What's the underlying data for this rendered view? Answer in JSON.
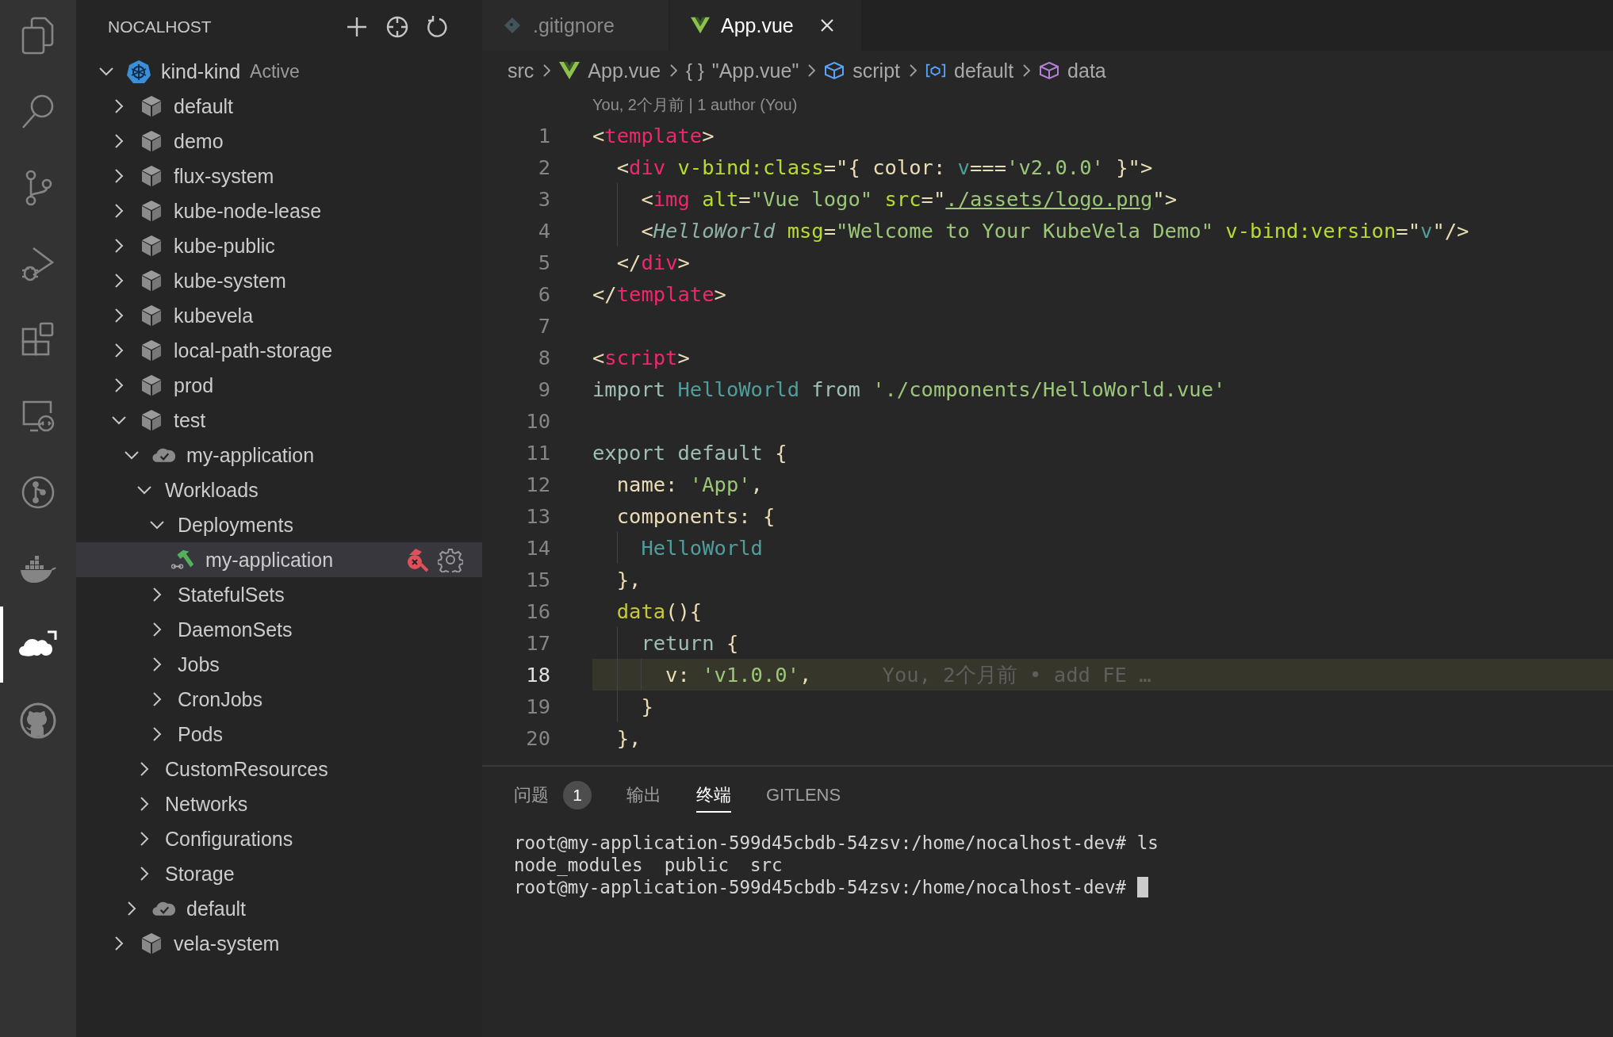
{
  "activity_bar": [
    {
      "kind": "files",
      "selected": false
    },
    {
      "kind": "search",
      "selected": false
    },
    {
      "kind": "source-control",
      "selected": false
    },
    {
      "kind": "run-debug",
      "selected": false
    },
    {
      "kind": "extensions",
      "selected": false
    },
    {
      "kind": "remote",
      "selected": false
    },
    {
      "kind": "git-graph",
      "selected": false
    },
    {
      "kind": "docker",
      "selected": false
    },
    {
      "kind": "nocalhost",
      "selected": true
    },
    {
      "kind": "github",
      "selected": false
    }
  ],
  "sidebar": {
    "title": "NOCALHOST",
    "tree": [
      {
        "label": "kind-kind",
        "description": "Active",
        "kind": "cluster",
        "expanded": true,
        "selected": false,
        "children": [
          {
            "label": "default",
            "kind": "namespace",
            "expanded": false,
            "selected": false
          },
          {
            "label": "demo",
            "kind": "namespace",
            "expanded": false,
            "selected": false
          },
          {
            "label": "flux-system",
            "kind": "namespace",
            "expanded": false,
            "selected": false
          },
          {
            "label": "kube-node-lease",
            "kind": "namespace",
            "expanded": false,
            "selected": false
          },
          {
            "label": "kube-public",
            "kind": "namespace",
            "expanded": false,
            "selected": false
          },
          {
            "label": "kube-system",
            "kind": "namespace",
            "expanded": false,
            "selected": false
          },
          {
            "label": "kubevela",
            "kind": "namespace",
            "expanded": false,
            "selected": false
          },
          {
            "label": "local-path-storage",
            "kind": "namespace",
            "expanded": false,
            "selected": false
          },
          {
            "label": "prod",
            "kind": "namespace",
            "expanded": false,
            "selected": false
          },
          {
            "label": "test",
            "kind": "namespace",
            "expanded": true,
            "selected": false,
            "children": [
              {
                "label": "my-application",
                "kind": "app",
                "expanded": true,
                "selected": false,
                "children": [
                  {
                    "label": "Workloads",
                    "expanded": true,
                    "selected": false,
                    "children": [
                      {
                        "label": "Deployments",
                        "expanded": true,
                        "selected": false,
                        "children": [
                          {
                            "label": "my-application",
                            "kind": "workload",
                            "selected": true
                          }
                        ]
                      },
                      {
                        "label": "StatefulSets",
                        "expanded": false,
                        "selected": false
                      },
                      {
                        "label": "DaemonSets",
                        "expanded": false,
                        "selected": false
                      },
                      {
                        "label": "Jobs",
                        "expanded": false,
                        "selected": false
                      },
                      {
                        "label": "CronJobs",
                        "expanded": false,
                        "selected": false
                      },
                      {
                        "label": "Pods",
                        "expanded": false,
                        "selected": false
                      }
                    ]
                  },
                  {
                    "label": "CustomResources",
                    "expanded": false,
                    "selected": false
                  },
                  {
                    "label": "Networks",
                    "expanded": false,
                    "selected": false
                  },
                  {
                    "label": "Configurations",
                    "expanded": false,
                    "selected": false
                  },
                  {
                    "label": "Storage",
                    "expanded": false,
                    "selected": false
                  }
                ]
              },
              {
                "label": "default",
                "kind": "app",
                "expanded": false,
                "selected": false
              }
            ]
          },
          {
            "label": "vela-system",
            "kind": "namespace",
            "expanded": false,
            "selected": false
          }
        ]
      }
    ]
  },
  "tabs": [
    {
      "label": ".gitignore",
      "kind": "git",
      "selected": false
    },
    {
      "label": "App.vue",
      "kind": "vue",
      "selected": true
    }
  ],
  "breadcrumbs": [
    {
      "label": "src",
      "kind": "folder"
    },
    {
      "label": "App.vue",
      "kind": "vue"
    },
    {
      "label": "\"App.vue\"",
      "kind": "braces",
      "glyph": "{ }"
    },
    {
      "label": "script",
      "kind": "module"
    },
    {
      "label": "default",
      "kind": "variable"
    },
    {
      "label": "data",
      "kind": "method"
    }
  ],
  "editor": {
    "codelens": "You, 2个月前 | 1 author (You)",
    "lines": [
      {
        "number": "1",
        "current": false,
        "tokens": [
          {
            "kind": "p",
            "text": "<"
          },
          {
            "kind": "tag",
            "text": "template"
          },
          {
            "kind": "p",
            "text": ">"
          }
        ]
      },
      {
        "number": "2",
        "current": false,
        "tokens": [
          {
            "kind": "p",
            "text": "  <"
          },
          {
            "kind": "tag",
            "text": "div"
          },
          {
            "kind": "attr",
            "text": " v-bind:class"
          },
          {
            "kind": "p",
            "text": "=\"{ color: "
          },
          {
            "kind": "ident",
            "text": "v"
          },
          {
            "kind": "p",
            "text": "==="
          },
          {
            "kind": "string",
            "text": "'v2.0.0'"
          },
          {
            "kind": "p",
            "text": " }\">"
          }
        ]
      },
      {
        "number": "3",
        "current": false,
        "tokens": [
          {
            "kind": "p",
            "text": "    <"
          },
          {
            "kind": "tag",
            "text": "img"
          },
          {
            "kind": "attr",
            "text": " alt"
          },
          {
            "kind": "p",
            "text": "="
          },
          {
            "kind": "string",
            "text": "\"Vue logo\""
          },
          {
            "kind": "attr",
            "text": " src"
          },
          {
            "kind": "p",
            "text": "=\""
          },
          {
            "kind": "link",
            "text": "./assets/logo.png"
          },
          {
            "kind": "p",
            "text": "\">"
          }
        ]
      },
      {
        "number": "4",
        "current": false,
        "tokens": [
          {
            "kind": "p",
            "text": "    <"
          },
          {
            "kind": "component",
            "text": "HelloWorld"
          },
          {
            "kind": "attr",
            "text": " msg"
          },
          {
            "kind": "p",
            "text": "="
          },
          {
            "kind": "string",
            "text": "\"Welcome to Your KubeVela Demo\""
          },
          {
            "kind": "attr",
            "text": " v-bind:version"
          },
          {
            "kind": "p",
            "text": "=\""
          },
          {
            "kind": "ident",
            "text": "v"
          },
          {
            "kind": "p",
            "text": "\"/>"
          }
        ]
      },
      {
        "number": "5",
        "current": false,
        "tokens": [
          {
            "kind": "p",
            "text": "  </"
          },
          {
            "kind": "tag",
            "text": "div"
          },
          {
            "kind": "p",
            "text": ">"
          }
        ]
      },
      {
        "number": "6",
        "current": false,
        "tokens": [
          {
            "kind": "p",
            "text": "</"
          },
          {
            "kind": "tag",
            "text": "template"
          },
          {
            "kind": "p",
            "text": ">"
          }
        ]
      },
      {
        "number": "7",
        "current": false
      },
      {
        "number": "8",
        "current": false,
        "tokens": [
          {
            "kind": "p",
            "text": "<"
          },
          {
            "kind": "tag",
            "text": "script"
          },
          {
            "kind": "p",
            "text": ">"
          }
        ]
      },
      {
        "number": "9",
        "current": false,
        "tokens": [
          {
            "kind": "kw",
            "text": "import "
          },
          {
            "kind": "ident",
            "text": "HelloWorld"
          },
          {
            "kind": "kw",
            "text": " from "
          },
          {
            "kind": "string",
            "text": "'./components/HelloWorld.vue'"
          }
        ]
      },
      {
        "number": "10",
        "current": false
      },
      {
        "number": "11",
        "current": false,
        "tokens": [
          {
            "kind": "kw",
            "text": "export default "
          },
          {
            "kind": "p",
            "text": "{"
          }
        ]
      },
      {
        "number": "12",
        "current": false,
        "tokens": [
          {
            "kind": "p",
            "text": "  name: "
          },
          {
            "kind": "string",
            "text": "'App'"
          },
          {
            "kind": "p",
            "text": ","
          }
        ]
      },
      {
        "number": "13",
        "current": false,
        "tokens": [
          {
            "kind": "p",
            "text": "  components: {"
          }
        ]
      },
      {
        "number": "14",
        "current": false,
        "tokens": [
          {
            "kind": "ident",
            "text": "    HelloWorld"
          }
        ]
      },
      {
        "number": "15",
        "current": false,
        "tokens": [
          {
            "kind": "p",
            "text": "  },"
          }
        ]
      },
      {
        "number": "16",
        "current": false,
        "tokens": [
          {
            "kind": "func",
            "text": "  data"
          },
          {
            "kind": "p",
            "text": "(){"
          }
        ]
      },
      {
        "number": "17",
        "current": false,
        "tokens": [
          {
            "kind": "kw",
            "text": "    return "
          },
          {
            "kind": "p",
            "text": "{"
          }
        ]
      },
      {
        "number": "18",
        "current": true,
        "blame": "You, 2个月前 • add FE …",
        "tokens": [
          {
            "kind": "p",
            "text": "      v: "
          },
          {
            "kind": "string",
            "text": "'v1.0.0'"
          },
          {
            "kind": "p",
            "text": ","
          }
        ]
      },
      {
        "number": "19",
        "current": false,
        "tokens": [
          {
            "kind": "p",
            "text": "    }"
          }
        ]
      },
      {
        "number": "20",
        "current": false,
        "tokens": [
          {
            "kind": "p",
            "text": "  },"
          }
        ]
      }
    ]
  },
  "panel": {
    "tabs": [
      {
        "label": "问题",
        "badge": "1",
        "selected": false
      },
      {
        "label": "输出",
        "selected": false
      },
      {
        "label": "终端",
        "selected": true
      },
      {
        "label": "GITLENS",
        "selected": false
      }
    ],
    "terminal": {
      "cursor": true,
      "lines": [
        "root@my-application-599d45cbdb-54zsv:/home/nocalhost-dev# ls",
        "node_modules  public  src",
        "root@my-application-599d45cbdb-54zsv:/home/nocalhost-dev#"
      ]
    }
  }
}
